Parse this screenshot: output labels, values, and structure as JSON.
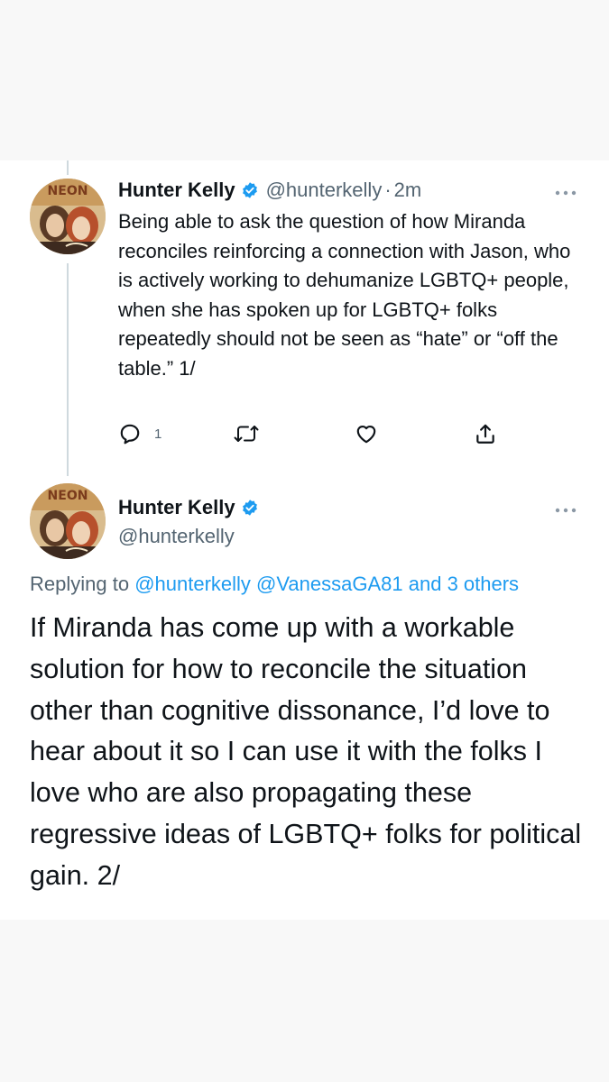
{
  "tweet1": {
    "author": {
      "display_name": "Hunter Kelly",
      "handle": "@hunterkelly",
      "verified": true,
      "avatar_icon": "avatar-photo"
    },
    "separator": "·",
    "timestamp": "2m",
    "text": "Being able to ask the question of how Miranda reconciles reinforcing a connection with Jason, who is actively working to dehumanize LGBTQ+ people, when she has spoken up for LGBTQ+ folks repeatedly should not be seen as “hate” or “off the table.” 1/",
    "actions": {
      "reply_count": "1",
      "icons": [
        "reply-icon",
        "retweet-icon",
        "like-icon",
        "share-icon"
      ]
    },
    "more_icon": "more-icon"
  },
  "tweet2": {
    "author": {
      "display_name": "Hunter Kelly",
      "handle": "@hunterkelly",
      "verified": true
    },
    "replying_to": {
      "prefix": "Replying to ",
      "mention_1": "@hunterkelly",
      "mention_2": "@VanessaGA81",
      "others": "and 3 others"
    },
    "text": "If Miranda has come up with a workable solution for how to reconcile the situation other than cognitive dissonance, I’d love to hear about it so I can use it with the folks I love who are also propagating these regressive ideas of LGBTQ+ folks for political gain. 2/",
    "more_icon": "more-icon"
  },
  "colors": {
    "text_primary": "#0f1419",
    "text_secondary": "#536471",
    "link_blue": "#1d9bf0",
    "thread_line": "#cfd9de",
    "background": "#f8f8f8",
    "card": "#ffffff"
  }
}
